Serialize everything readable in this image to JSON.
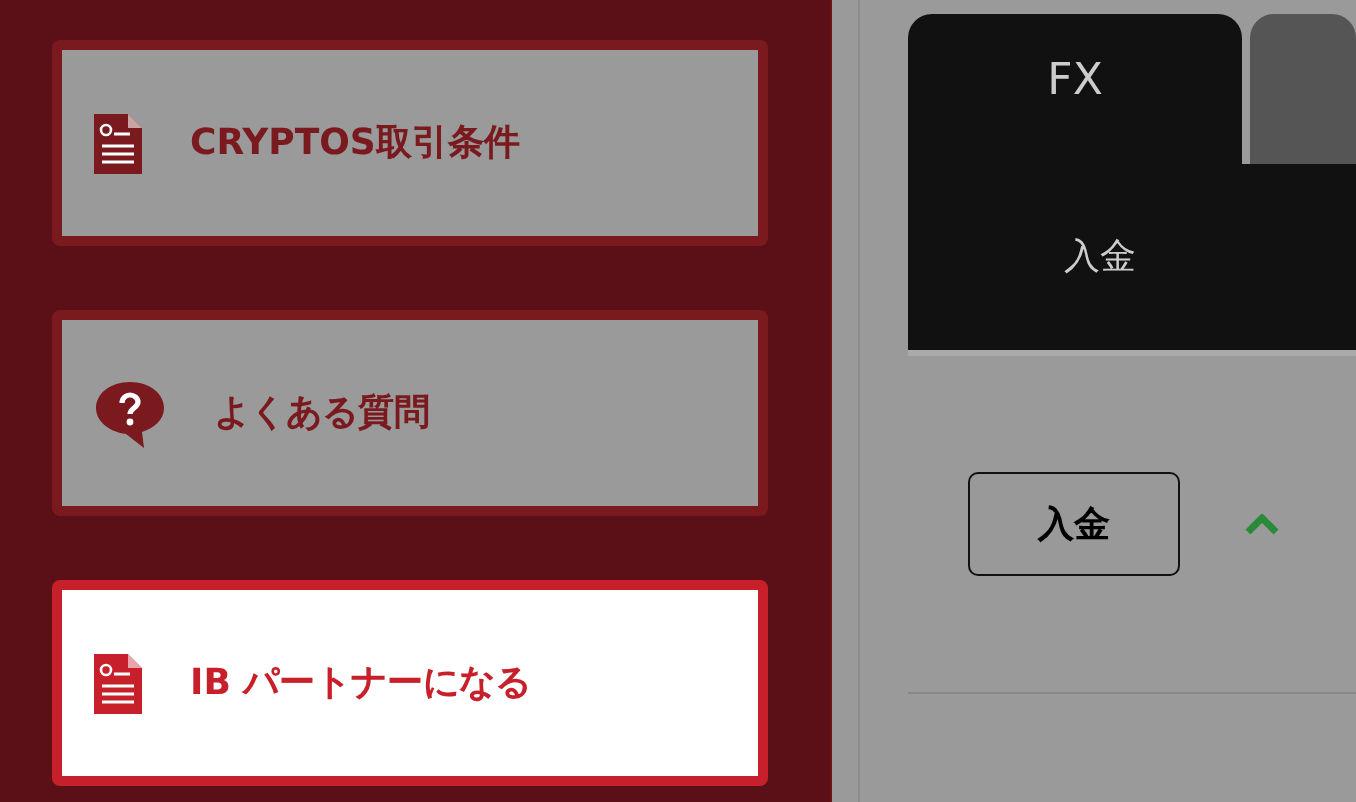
{
  "sidebar": {
    "items": [
      {
        "label": "CRYPTOS取引条件",
        "kind": "document",
        "selected": false
      },
      {
        "label": "よくある質問",
        "kind": "question",
        "selected": false
      },
      {
        "label": "IB パートナーになる",
        "kind": "document",
        "selected": true
      }
    ]
  },
  "tabs": [
    {
      "label": "FX",
      "selected": true
    },
    {
      "selected": false
    }
  ],
  "subtabs": [
    {
      "label": "入金"
    }
  ],
  "deposit_button": "入金"
}
